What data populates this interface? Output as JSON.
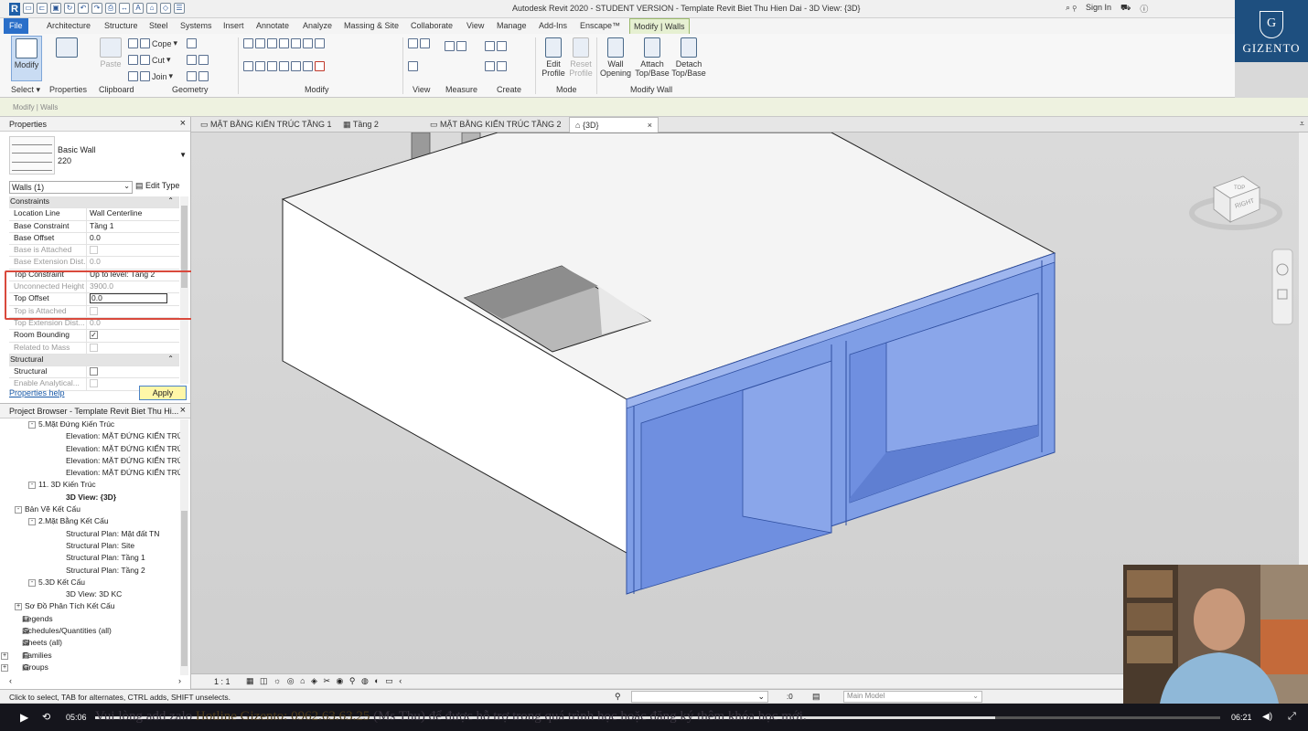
{
  "app": {
    "title": "Autodesk Revit 2020 - STUDENT VERSION - Template Revit Biet Thu Hien Dai - 3D View: {3D}",
    "sign_in": "Sign In",
    "logo_text": "GIZENTO",
    "logo_letter": "G"
  },
  "ribbon_tabs": [
    "File",
    "Architecture",
    "Structure",
    "Steel",
    "Systems",
    "Insert",
    "Annotate",
    "Analyze",
    "Massing & Site",
    "Collaborate",
    "View",
    "Manage",
    "Add-Ins",
    "Enscape™",
    "Modify | Walls"
  ],
  "ribbon": {
    "modify_label": "Modify",
    "paste_label": "Paste",
    "cope_label": "Cope",
    "cut_label": "Cut",
    "join_label": "Join",
    "edit_profile": "Edit Profile",
    "reset_profile": "Reset Profile",
    "wall_opening": "Wall Opening",
    "attach": "Attach Top/Base",
    "detach": "Detach Top/Base",
    "groups": [
      "Select ▾",
      "Properties",
      "Clipboard",
      "Geometry",
      "Modify",
      "View",
      "Measure",
      "Create",
      "Mode",
      "Modify Wall"
    ]
  },
  "context_label": "Modify | Walls",
  "properties": {
    "title": "Properties",
    "type_family": "Basic Wall",
    "type_name": "220",
    "instance": "Walls (1)",
    "edit_type": "Edit Type",
    "constraints_header": "Constraints",
    "structural_header": "Structural",
    "rows": [
      {
        "k": "Location Line",
        "v": "Wall Centerline",
        "state": "normal"
      },
      {
        "k": "Base Constraint",
        "v": "Tầng 1",
        "state": "normal"
      },
      {
        "k": "Base Offset",
        "v": "0.0",
        "state": "normal"
      },
      {
        "k": "Base is Attached",
        "v": "",
        "state": "disabled-check"
      },
      {
        "k": "Base Extension Dist...",
        "v": "0.0",
        "state": "disabled"
      },
      {
        "k": "Top Constraint",
        "v": "Up to level: Tầng 2",
        "state": "normal"
      },
      {
        "k": "Unconnected Height",
        "v": "3900.0",
        "state": "disabled"
      },
      {
        "k": "Top Offset",
        "v": "0.0",
        "state": "edit"
      },
      {
        "k": "Top is Attached",
        "v": "",
        "state": "disabled-check"
      },
      {
        "k": "Top Extension Dist...",
        "v": "0.0",
        "state": "disabled"
      },
      {
        "k": "Room Bounding",
        "v": "✓",
        "state": "check"
      },
      {
        "k": "Related to Mass",
        "v": "",
        "state": "disabled-check"
      }
    ],
    "structural_rows": [
      {
        "k": "Structural",
        "v": "",
        "state": "check"
      },
      {
        "k": "Enable Analytical...",
        "v": "",
        "state": "disabled-check"
      }
    ],
    "help": "Properties help",
    "apply": "Apply"
  },
  "browser": {
    "title": "Project Browser - Template Revit Biet Thu Hi...",
    "items": [
      {
        "label": "5.Mặt Đứng Kiến Trúc",
        "level": 2,
        "exp": "-",
        "bold": false
      },
      {
        "label": "Elevation: MẶT ĐỨNG KIẾN TRÚ",
        "level": 4,
        "exp": "",
        "bold": false
      },
      {
        "label": "Elevation: MẶT ĐỨNG KIẾN TRÚ",
        "level": 4,
        "exp": "",
        "bold": false
      },
      {
        "label": "Elevation: MẶT ĐỨNG KIẾN TRÚ",
        "level": 4,
        "exp": "",
        "bold": false
      },
      {
        "label": "Elevation: MẶT ĐỨNG KIẾN TRÚ",
        "level": 4,
        "exp": "",
        "bold": false
      },
      {
        "label": "11. 3D Kiến Trúc",
        "level": 2,
        "exp": "-",
        "bold": false
      },
      {
        "label": "3D View: {3D}",
        "level": 4,
        "exp": "",
        "bold": true
      },
      {
        "label": "Bản Vẽ Kết Cấu",
        "level": 1,
        "exp": "-",
        "bold": false
      },
      {
        "label": "2.Mặt Bằng Kết Cấu",
        "level": 2,
        "exp": "-",
        "bold": false
      },
      {
        "label": "Structural Plan: Mặt đất TN",
        "level": 4,
        "exp": "",
        "bold": false
      },
      {
        "label": "Structural Plan: Site",
        "level": 4,
        "exp": "",
        "bold": false
      },
      {
        "label": "Structural Plan: Tầng 1",
        "level": 4,
        "exp": "",
        "bold": false
      },
      {
        "label": "Structural Plan: Tầng 2",
        "level": 4,
        "exp": "",
        "bold": false
      },
      {
        "label": "5.3D Kết Cấu",
        "level": 2,
        "exp": "-",
        "bold": false
      },
      {
        "label": "3D View: 3D KC",
        "level": 4,
        "exp": "",
        "bold": false
      },
      {
        "label": "Sơ Đồ Phân Tích Kết Cấu",
        "level": 1,
        "exp": "+",
        "bold": false
      },
      {
        "label": "Legends",
        "level": 0,
        "exp": "",
        "bold": false
      },
      {
        "label": "Schedules/Quantities (all)",
        "level": 0,
        "exp": "",
        "bold": false
      },
      {
        "label": "Sheets (all)",
        "level": 0,
        "exp": "",
        "bold": false
      },
      {
        "label": "Families",
        "level": 0,
        "exp": "+",
        "bold": false
      },
      {
        "label": "Groups",
        "level": 0,
        "exp": "+",
        "bold": false
      }
    ]
  },
  "view_tabs": [
    "MẶT BẰNG KIẾN TRÚC TẦNG 1",
    "Tầng 2",
    "MẶT BẰNG KIẾN TRÚC TẦNG 2",
    "{3D}"
  ],
  "viewcube": {
    "face_top": "TOP",
    "face_right": "RIGHT"
  },
  "view_control": {
    "scale": "1 : 1"
  },
  "status": {
    "message": "Click to select, TAB for alternates, CTRL adds, SHIFT unselects.",
    "zero": ":0",
    "model": "Main Model"
  },
  "player": {
    "current": "05:06",
    "total": "06:21",
    "progress": 0.8,
    "marquee_a": "Vui lòng add zalo ",
    "marquee_b": "Hotline Gizento: 0962.63.63.25",
    "marquee_c": " (Ms Thu) để được hỗ trợ trong quá trình học hoặc đăng ký thêm khóa học mới."
  },
  "colors": {
    "selected_wall": "#6f8fe0",
    "accent": "#2a6fc9",
    "highlight_box": "#d9493c"
  }
}
